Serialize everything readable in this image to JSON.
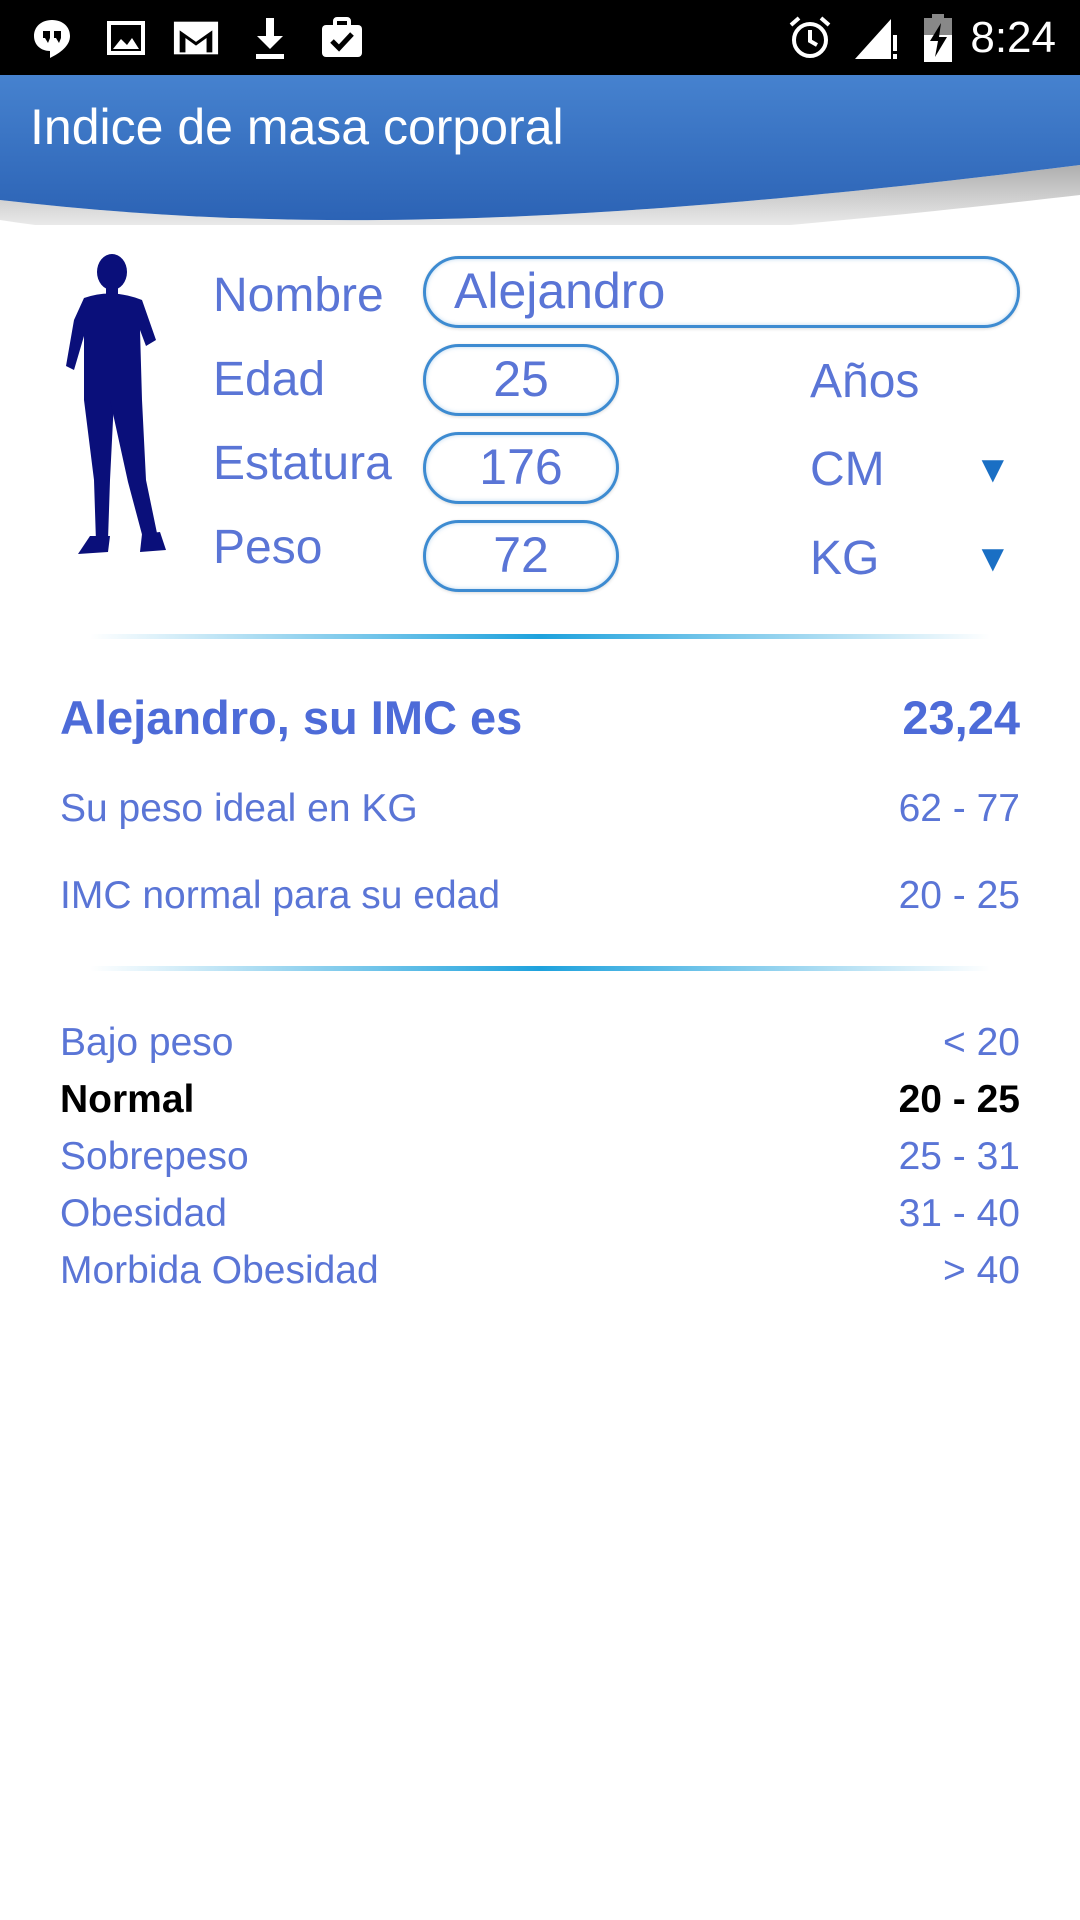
{
  "status_bar": {
    "left_icons": [
      "hangouts-icon",
      "image-icon",
      "gmail-icon",
      "download-icon",
      "clipboard-check-icon"
    ],
    "right_icons": [
      "alarm-icon",
      "signal-icon",
      "battery-charging-icon"
    ],
    "time": "8:24"
  },
  "app_bar": {
    "title": "Indice de masa corporal",
    "color": "#3a74c2"
  },
  "form": {
    "nombre_label": "Nombre",
    "nombre_value": "Alejandro",
    "edad_label": "Edad",
    "edad_value": "25",
    "edad_unit": "Años",
    "estatura_label": "Estatura",
    "estatura_value": "176",
    "estatura_unit": "CM",
    "peso_label": "Peso",
    "peso_value": "72",
    "peso_unit": "KG",
    "dropdown_arrow": "▼"
  },
  "results": {
    "imc_label": "Alejandro, su IMC es",
    "imc_value": "23,24",
    "ideal_label": "Su peso ideal en KG",
    "ideal_value": "62 - 77",
    "normal_label": "IMC normal para su edad",
    "normal_value": "20 - 25"
  },
  "categories": [
    {
      "name": "Bajo peso",
      "range": "< 20",
      "active": false
    },
    {
      "name": "Normal",
      "range": "20 - 25",
      "active": true
    },
    {
      "name": "Sobrepeso",
      "range": "25 - 31",
      "active": false
    },
    {
      "name": "Obesidad",
      "range": "31 - 40",
      "active": false
    },
    {
      "name": "Morbida Obesidad",
      "range": "> 40",
      "active": false
    }
  ],
  "colors": {
    "text_blue": "#5a75d6",
    "field_border": "#3d8bd1",
    "divider": "#1ea2dd",
    "silhouette": "#0a0f7a"
  }
}
